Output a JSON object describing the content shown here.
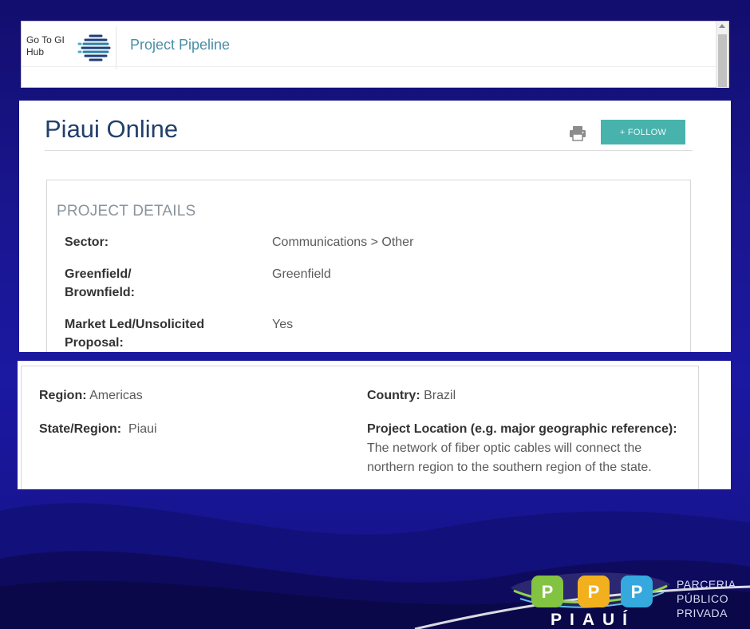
{
  "header": {
    "gi_hub_link": "Go To GI Hub",
    "title": "Project Pipeline"
  },
  "project": {
    "title": "Piaui Online",
    "follow_label": "+ FOLLOW",
    "print_icon": "printer-icon",
    "details_heading": "PROJECT DETAILS",
    "details": [
      {
        "label": "Sector:",
        "value": "Communications > Other"
      },
      {
        "label": "Greenfield/ Brownfield:",
        "value": "Greenfield"
      },
      {
        "label": "Market Led/Unsolicited Proposal:",
        "value": "Yes"
      }
    ]
  },
  "location": {
    "region_label": "Region:",
    "region_value": "Americas",
    "country_label": "Country:",
    "country_value": "Brazil",
    "state_label": "State/Region:",
    "state_value": "Piaui",
    "project_location_label": "Project Location (e.g. major geographic reference):",
    "project_location_value": "The network of fiber optic cables will connect the northern region to the southern region of the state."
  },
  "brand": {
    "letters": [
      "P",
      "P",
      "P"
    ],
    "wordmark": "PIAUÍ",
    "lines": [
      "PARCERIA",
      "PÚBLICO",
      "PRIVADA"
    ]
  },
  "colors": {
    "accent_teal": "#48b3ad",
    "title_navy": "#22406a",
    "pipeline_blue": "#4a8ea6",
    "background_navy": "#1a1690"
  }
}
